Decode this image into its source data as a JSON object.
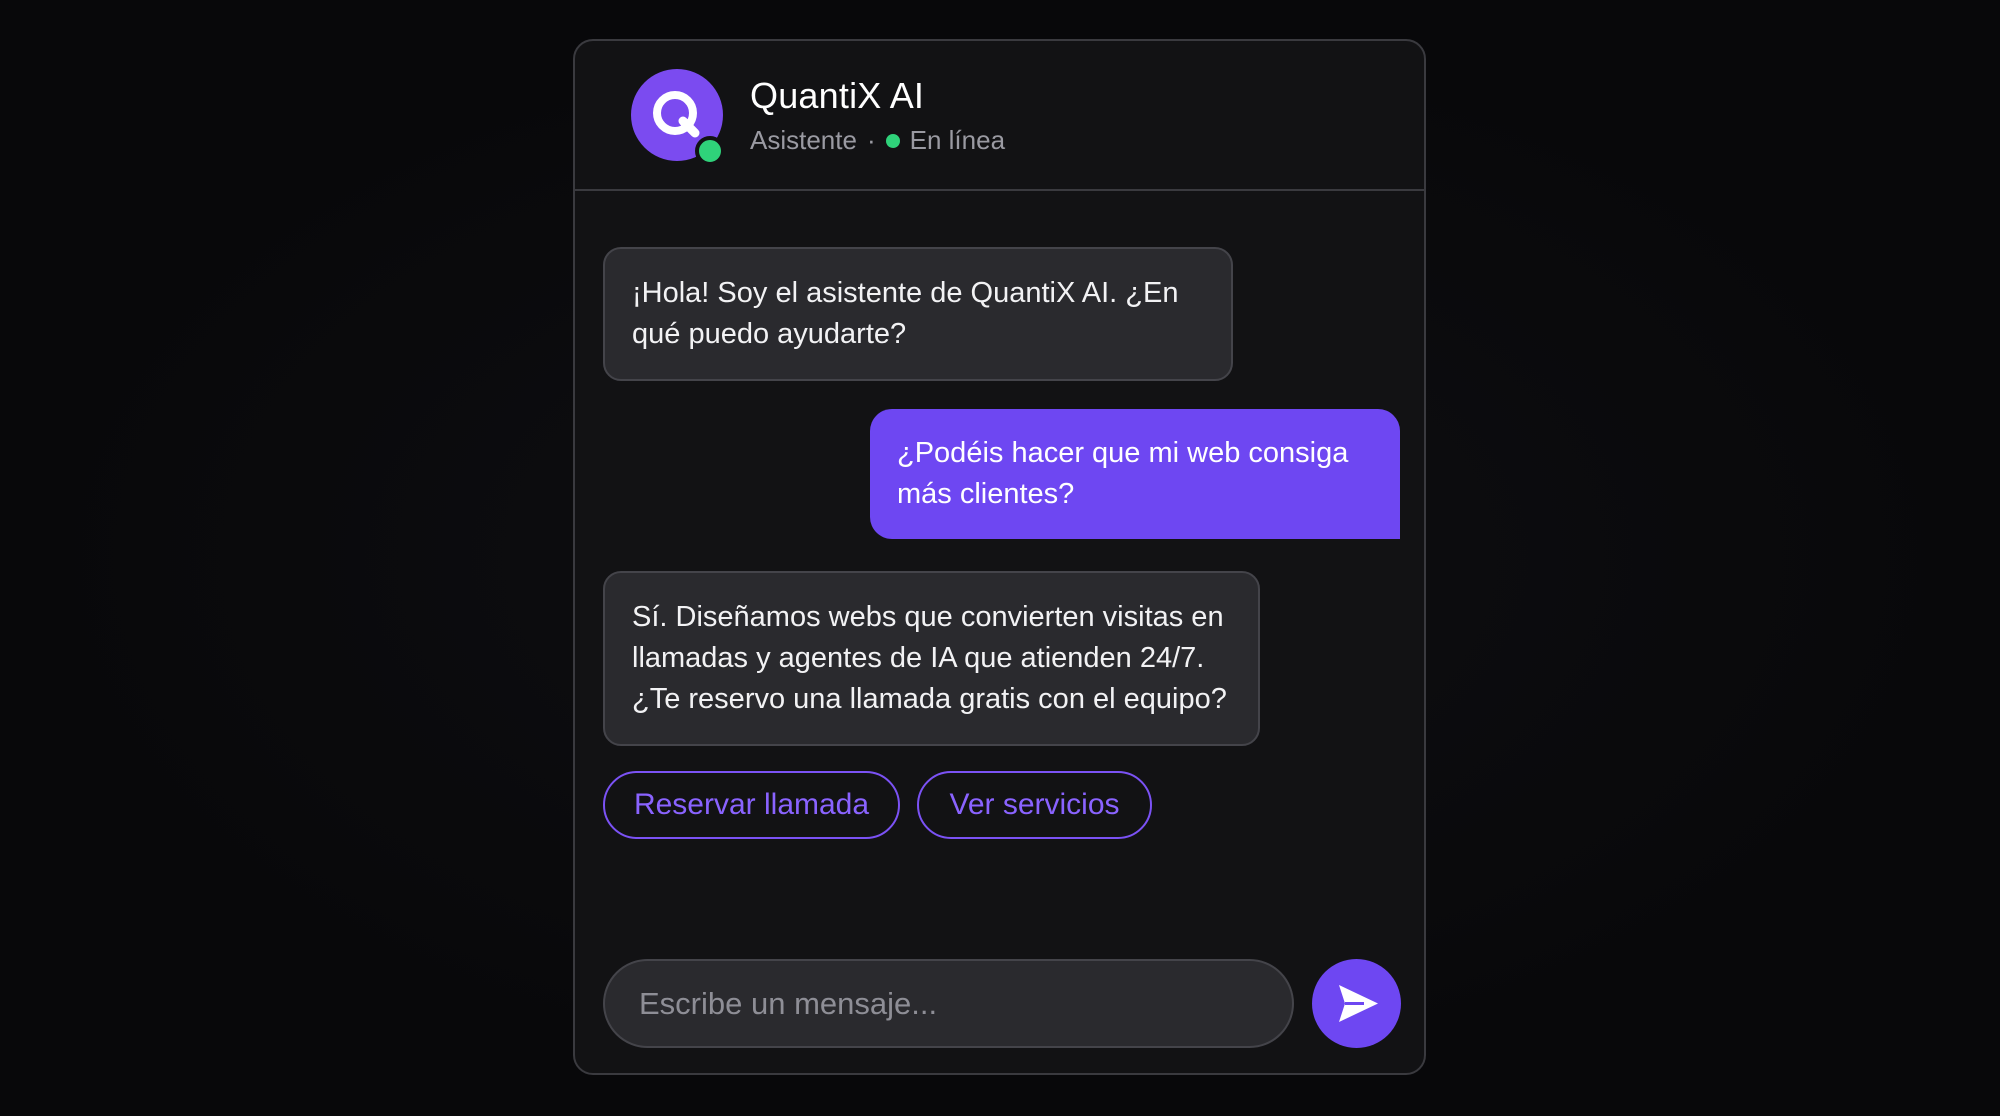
{
  "header": {
    "title": "QuantiX AI",
    "role": "Asistente",
    "separator": "·",
    "status": "En línea",
    "avatar_letter": "Q"
  },
  "messages": [
    {
      "sender": "bot",
      "lines": [
        "¡Hola! Soy el asistente de QuantiX AI. ¿En",
        "qué puedo ayudarte?"
      ]
    },
    {
      "sender": "user",
      "lines": [
        "¿Podéis hacer que mi web consiga",
        "más clientes?"
      ]
    },
    {
      "sender": "bot",
      "lines": [
        "Sí. Diseñamos webs que convierten visitas en",
        "llamadas y agentes de IA que atienden 24/7.",
        "¿Te reservo una llamada gratis con el equipo?"
      ]
    }
  ],
  "quick_replies": [
    "Reservar llamada",
    "Ver servicios"
  ],
  "composer": {
    "placeholder": "Escribe un mensaje...",
    "send_icon": "send-icon"
  },
  "colors": {
    "accent": "#6e47f2",
    "online": "#2fd27a",
    "bubble_bot": "#2a2a2e",
    "background": "#121214"
  }
}
